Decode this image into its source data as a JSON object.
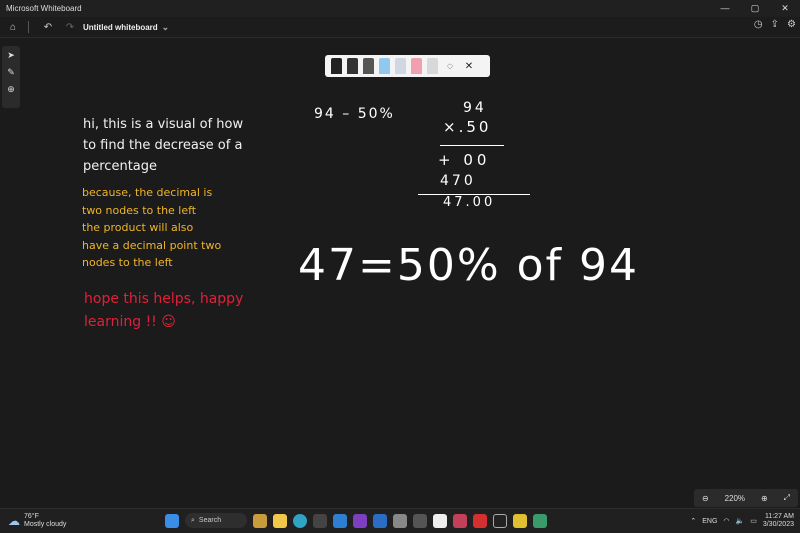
{
  "window": {
    "title": "Microsoft Whiteboard",
    "controls": [
      "—",
      "▢",
      "✕"
    ]
  },
  "appbar": {
    "doc_title": "Untitled whiteboard",
    "chevron": "⌄"
  },
  "toolbar": {
    "colors": [
      "#222222",
      "#333333",
      "#555555",
      "#90c8f0",
      "#cfd8e0",
      "#f0a0b0",
      "#d8d8d8"
    ]
  },
  "notes": {
    "intro": [
      "hi, this is a visual of how",
      "to find the decrease of a",
      "percentage"
    ],
    "explain": [
      "because, the decimal is",
      "two nodes to the left",
      "the product will also",
      "have a decimal point two",
      "nodes to the left"
    ],
    "closing": [
      "hope this helps, happy",
      "learning !! ☺"
    ]
  },
  "math": {
    "problem": "94 – 50%",
    "mult_top": "94",
    "mult_bottom": "×.50",
    "row1": "+ 00",
    "row2": "470",
    "result_row": "47.00",
    "answer": "47=50% of 94"
  },
  "zoom": {
    "level": "220%",
    "out": "⊖",
    "in": "⊕"
  },
  "taskbar": {
    "temp": "76°F",
    "weather": "Mostly cloudy",
    "search": "Search",
    "lang": "ENG",
    "time": "11:27 AM",
    "date": "3/30/2023"
  }
}
